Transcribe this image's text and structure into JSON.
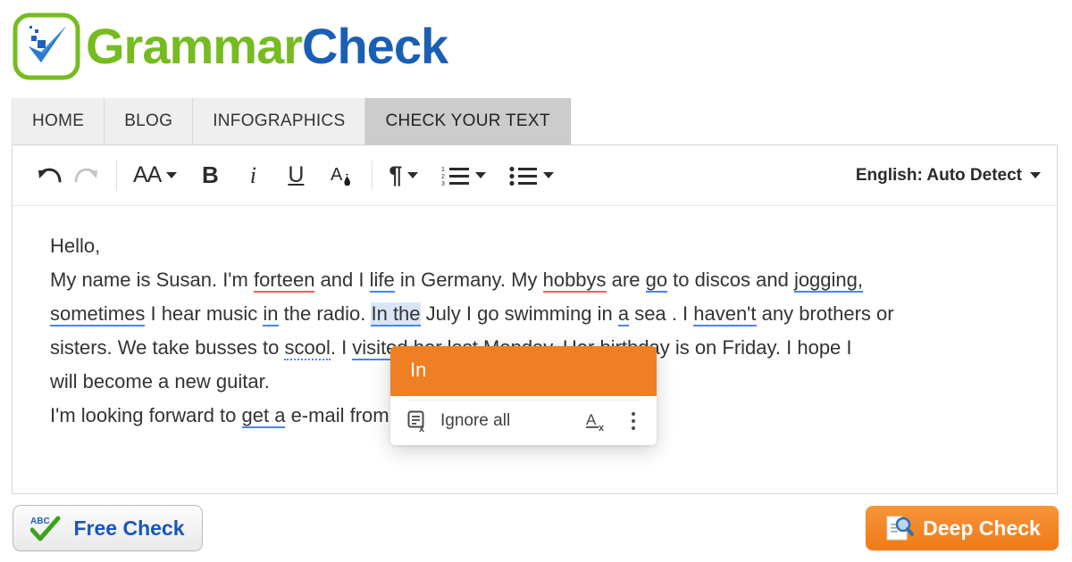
{
  "brand": {
    "name_part1": "Grammar",
    "name_part2": "Check",
    "logo_icon": "checkmark-badge-icon",
    "green": "#76bc21",
    "blue": "#1a5fb4"
  },
  "nav": {
    "items": [
      {
        "label": "HOME",
        "active": false
      },
      {
        "label": "BLOG",
        "active": false
      },
      {
        "label": "INFOGRAPHICS",
        "active": false
      },
      {
        "label": "CHECK YOUR TEXT",
        "active": true
      }
    ]
  },
  "toolbar": {
    "undo": "undo-icon",
    "redo": "redo-icon",
    "font_size": "AA",
    "bold": "B",
    "italic": "i",
    "underline": "U",
    "text_color": "text-color-icon",
    "paragraph": "¶",
    "numbered_list": "numbered-list-icon",
    "bulleted_list": "bulleted-list-icon",
    "language": "English: Auto Detect"
  },
  "document": {
    "line1": "Hello,",
    "line2_a": "My name is Susan. I'm ",
    "line2_err1": "forteen",
    "line2_b": " and I ",
    "line2_err2": "life",
    "line2_c": " in Germany. My ",
    "line2_err3": "hobbys",
    "line2_d": " are ",
    "line2_err4": "go",
    "line2_e": " to discos and ",
    "line2_err5": "jogging,",
    "line3_err1": "sometimes",
    "line3_a": " I hear music ",
    "line3_err2": "in",
    "line3_b": " the radio. ",
    "line3_active": "In the",
    "line3_c": " July I go swimming in ",
    "line3_err3": "a",
    "line3_d": " sea . I ",
    "line3_err4": "haven't",
    "line3_e": " any brothers or",
    "line4_a": "sisters. We take busses to ",
    "line4_err1": "scool",
    "line4_b": ". I ",
    "line4_err2": "visited",
    "line4_c": " her last Monday. Her birthday is on Friday. I hope I",
    "line5": "will become a new guitar.",
    "line6_a": "I'm looking forward to ",
    "line6_err1": "get a",
    "line6_b": " e-mail from you."
  },
  "popup": {
    "suggestion": "In",
    "ignore_label": "Ignore all",
    "ignore_icon": "ignore-all-icon",
    "clear_format_icon": "clear-formatting-icon",
    "more_icon": "kebab-menu-icon",
    "accent": "#ef7f24"
  },
  "footer": {
    "free_check_label": "Free Check",
    "free_check_icon": "abc-check-icon",
    "deep_check_label": "Deep Check",
    "deep_check_icon": "document-magnifier-icon",
    "deep_check_color": "#ef7a18"
  }
}
